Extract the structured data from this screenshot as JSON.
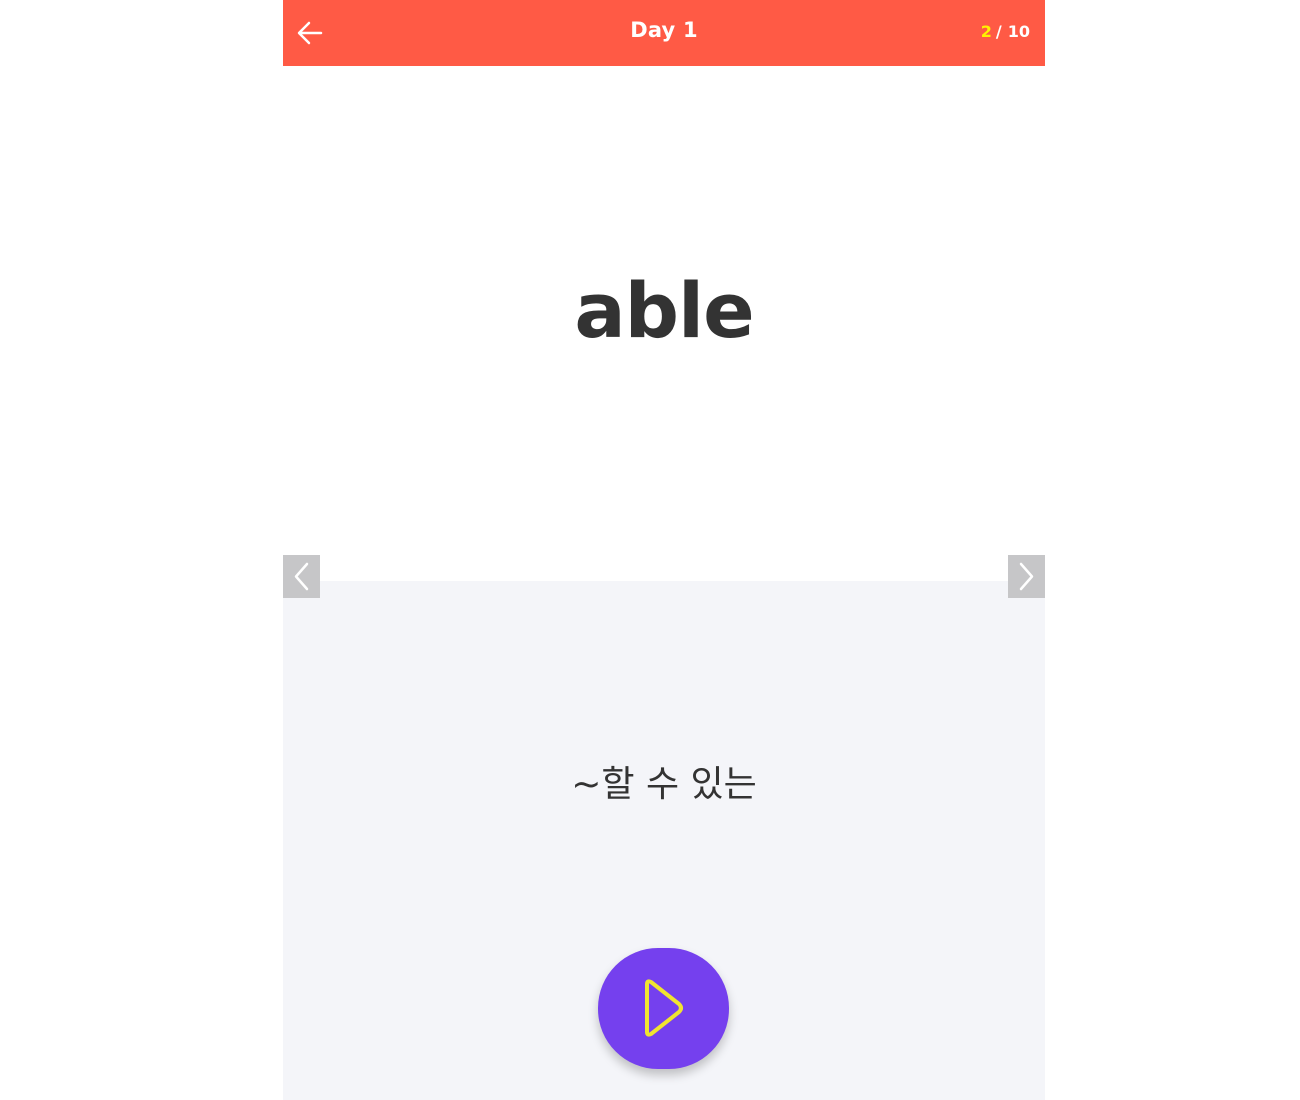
{
  "header": {
    "title": "Day 1",
    "current": "2",
    "separator": "/",
    "total": "10",
    "back_icon": "arrow-left-icon"
  },
  "card": {
    "word": "able",
    "meaning": "~할 수 있는"
  },
  "navigation": {
    "prev_icon": "chevron-left-icon",
    "next_icon": "chevron-right-icon"
  },
  "audio": {
    "play_icon": "play-icon"
  },
  "colors": {
    "header_bg": "#ff5a45",
    "current_counter": "#fff200",
    "play_button_bg": "#7540ee",
    "play_icon": "#f0e430",
    "meaning_bg": "#f4f5f9"
  }
}
